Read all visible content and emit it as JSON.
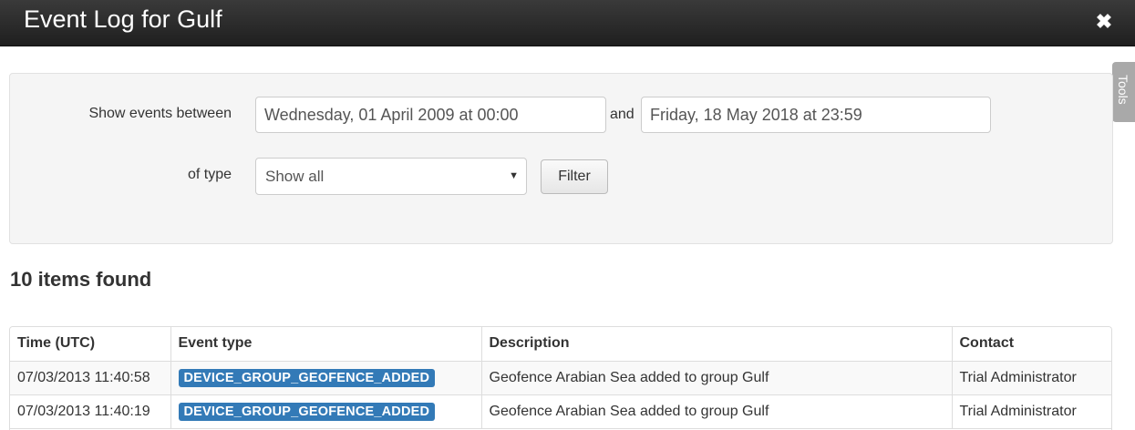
{
  "dialog": {
    "title": "Event Log for Gulf",
    "close_label": "✖"
  },
  "tools_tab": {
    "label": "Tools"
  },
  "filter": {
    "between_label": "Show events between",
    "from_value": "Wednesday, 01 April 2009 at 00:00",
    "and_label": "and",
    "to_value": "Friday, 18 May 2018 at 23:59",
    "type_label": "of type",
    "type_selected": "Show all",
    "filter_button": "Filter"
  },
  "results": {
    "count_text": "10 items found",
    "columns": [
      "Time (UTC)",
      "Event type",
      "Description",
      "Contact"
    ],
    "rows": [
      {
        "time": "07/03/2013 11:40:58",
        "event_type": "DEVICE_GROUP_GEOFENCE_ADDED",
        "description": "Geofence Arabian Sea added to group Gulf",
        "contact": "Trial Administrator"
      },
      {
        "time": "07/03/2013 11:40:19",
        "event_type": "DEVICE_GROUP_GEOFENCE_ADDED",
        "description": "Geofence Arabian Sea added to group Gulf",
        "contact": "Trial Administrator"
      }
    ]
  },
  "colors": {
    "titlebar": "#2b2b2b",
    "badge": "#337ab7",
    "panel": "#f5f5f5",
    "tools_tab": "#a9a9a9"
  }
}
